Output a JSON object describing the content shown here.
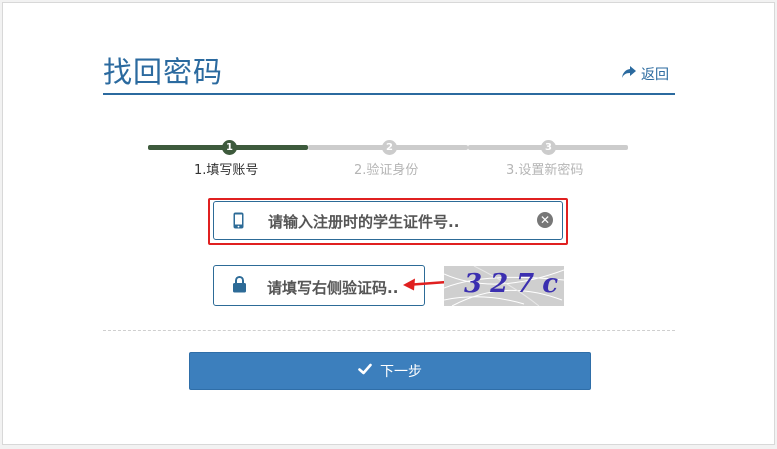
{
  "header": {
    "title": "找回密码",
    "back_label": "返回"
  },
  "steps": [
    {
      "index": "1",
      "label": "1.填写账号",
      "active": true
    },
    {
      "index": "2",
      "label": "2.验证身份",
      "active": false
    },
    {
      "index": "3",
      "label": "3.设置新密码",
      "active": false
    }
  ],
  "form": {
    "id_placeholder": "请输入注册时的学生证件号..",
    "captcha_placeholder": "请填写右侧验证码..",
    "captcha_text": "327c",
    "next_label": "下一步"
  },
  "colors": {
    "accent": "#2b6a9f",
    "step_active": "#3d5a3c",
    "step_inactive": "#cccccc",
    "highlight": "#e02020",
    "button": "#3c7fbd"
  },
  "icons": [
    "share-arrow-icon",
    "mobile-phone-icon",
    "clear-icon",
    "lock-icon",
    "check-icon"
  ]
}
